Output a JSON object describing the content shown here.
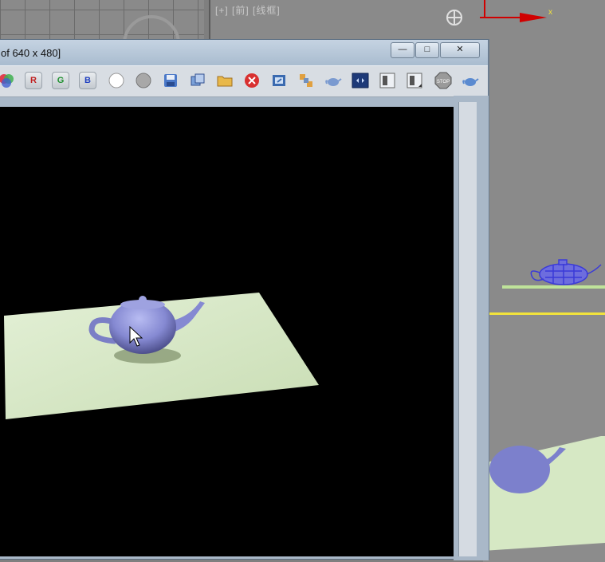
{
  "background": {
    "front_viewport_label": "[+] [前] [线框]",
    "persp_viewport_accent": "#f2e33b",
    "axis_label": "x"
  },
  "window": {
    "title": "of 640 x 480]",
    "minimize_glyph": "—",
    "maximize_glyph": "□",
    "close_glyph": "✕"
  },
  "toolbar": {
    "buttons": [
      {
        "name": "color-channels-icon"
      },
      {
        "name": "red-channel-button",
        "label": "R"
      },
      {
        "name": "green-channel-button",
        "label": "G"
      },
      {
        "name": "blue-channel-button",
        "label": "B"
      },
      {
        "name": "white-alpha-icon"
      },
      {
        "name": "gray-mono-icon"
      },
      {
        "name": "save-image-icon"
      },
      {
        "name": "clone-window-icon"
      },
      {
        "name": "open-folder-icon"
      },
      {
        "name": "clear-icon"
      },
      {
        "name": "print-icon"
      },
      {
        "name": "render-region-icon"
      },
      {
        "name": "render-teapot-icon"
      },
      {
        "name": "toggle-ui-icon"
      },
      {
        "name": "display-a-icon"
      },
      {
        "name": "display-b-icon"
      },
      {
        "name": "stop-icon",
        "label": "STOP"
      },
      {
        "name": "render-icon"
      }
    ]
  },
  "render": {
    "plane_color": "#d6e8c4",
    "teapot_color": "#8b8fd6",
    "background_color": "#000000"
  }
}
